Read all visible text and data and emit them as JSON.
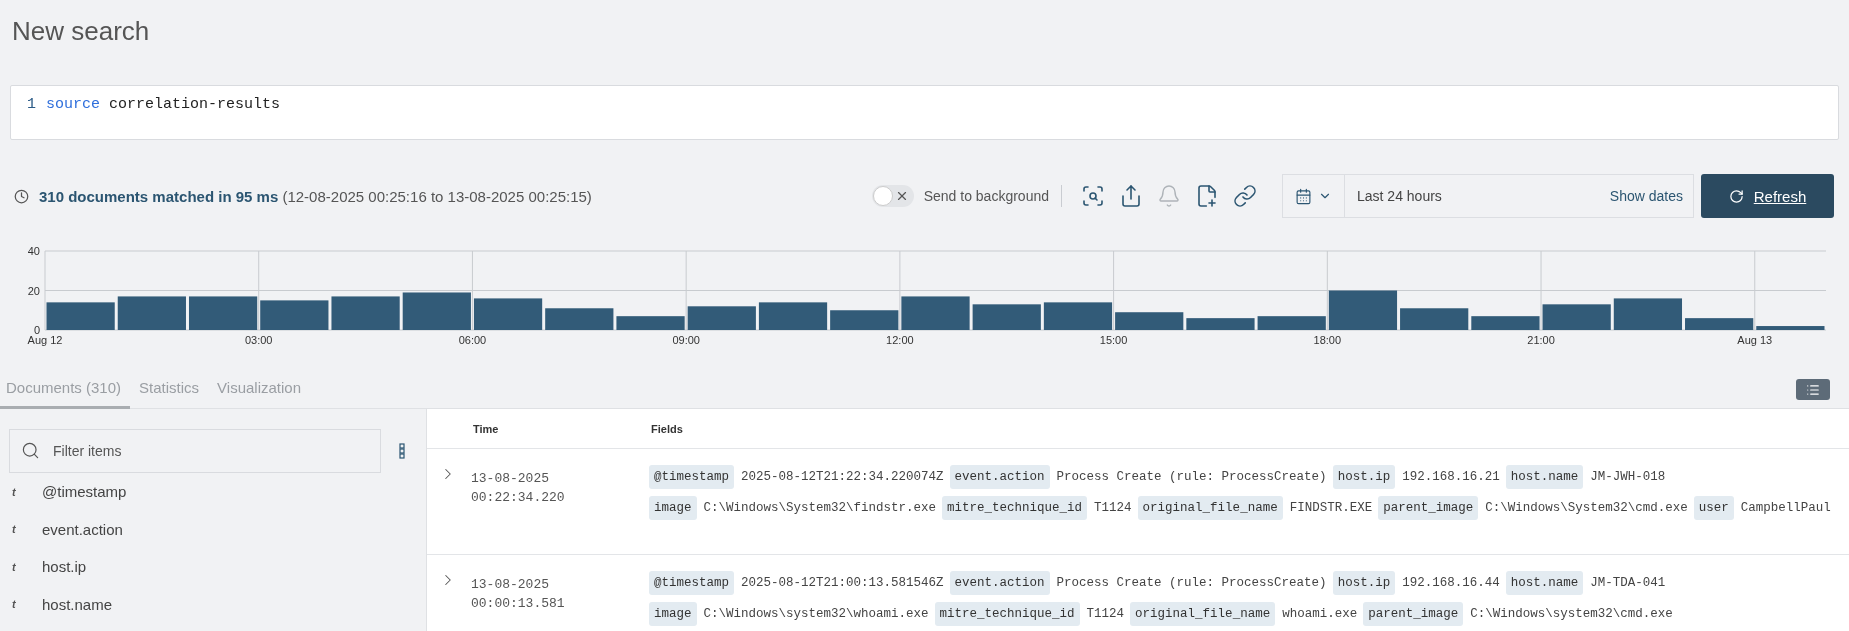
{
  "page_title": "New search",
  "query": {
    "line_number": "1",
    "keyword": "source",
    "argument": "correlation-results"
  },
  "summary": {
    "matched": "310 documents matched in 95 ms",
    "range": "(12-08-2025 00:25:16 to 13-08-2025 00:25:15)"
  },
  "background_toggle": {
    "label": "Send to background",
    "on": false
  },
  "toolbar_icons": [
    {
      "kind": "inspect",
      "disabled": false
    },
    {
      "kind": "export",
      "disabled": false
    },
    {
      "kind": "alert",
      "disabled": true
    },
    {
      "kind": "add-report",
      "disabled": false
    },
    {
      "kind": "link",
      "disabled": false
    }
  ],
  "time_range": {
    "value": "Last 24 hours",
    "show_dates": "Show dates"
  },
  "refresh_button": "Refresh",
  "histogram": {
    "chart_data": {
      "type": "bar",
      "x": [
        0.5,
        1.5,
        2.5,
        3.5,
        4.5,
        5.5,
        6.5,
        7.5,
        8.5,
        9.5,
        10.5,
        11.5,
        12.5,
        13.5,
        14.5,
        15.5,
        16.5,
        17.5,
        18.5,
        19.5,
        20.5,
        21.5,
        22.5,
        23.5,
        24.5
      ],
      "values": [
        14,
        17,
        17,
        15,
        17,
        19,
        16,
        11,
        7,
        12,
        14,
        10,
        17,
        13,
        14,
        9,
        6,
        7,
        20,
        11,
        7,
        13,
        16,
        6,
        2
      ],
      "xlim": [
        0,
        25
      ],
      "ylim": [
        0,
        40
      ],
      "grid": true,
      "yticks": [
        0,
        20,
        40
      ],
      "xticks": [
        {
          "value": 0,
          "label": "Aug 12"
        },
        {
          "value": 3,
          "label": "03:00"
        },
        {
          "value": 6,
          "label": "06:00"
        },
        {
          "value": 9,
          "label": "09:00"
        },
        {
          "value": 12,
          "label": "12:00"
        },
        {
          "value": 15,
          "label": "15:00"
        },
        {
          "value": 18,
          "label": "18:00"
        },
        {
          "value": 21,
          "label": "21:00"
        },
        {
          "value": 24,
          "label": "Aug 13"
        }
      ]
    }
  },
  "tabs": [
    {
      "label": "Documents (310)",
      "selected": true
    },
    {
      "label": "Statistics",
      "selected": false
    },
    {
      "label": "Visualization",
      "selected": false
    }
  ],
  "filter": {
    "placeholder": "Filter items"
  },
  "field_list": [
    {
      "type": "t",
      "name": "@timestamp"
    },
    {
      "type": "t",
      "name": "event.action"
    },
    {
      "type": "t",
      "name": "host.ip"
    },
    {
      "type": "t",
      "name": "host.name"
    }
  ],
  "table": {
    "columns": [
      "Time",
      "Fields"
    ],
    "rows": [
      {
        "date": "13-08-2025",
        "time": "00:22:34.220",
        "expanded": false,
        "fields": [
          {
            "key": "@timestamp",
            "value": "2025-08-12T21:22:34.220074Z"
          },
          {
            "key": "event.action",
            "value": "Process Create (rule: ProcessCreate)"
          },
          {
            "key": "host.ip",
            "value": "192.168.16.21"
          },
          {
            "key": "host.name",
            "value": "JM-JWH-018"
          },
          {
            "key": "image",
            "value": "C:\\Windows\\System32\\findstr.exe"
          },
          {
            "key": "mitre_technique_id",
            "value": "T1124"
          },
          {
            "key": "original_file_name",
            "value": "FINDSTR.EXE"
          },
          {
            "key": "parent_image",
            "value": "C:\\Windows\\System32\\cmd.exe"
          },
          {
            "key": "user",
            "value": "CampbellPaul"
          }
        ]
      },
      {
        "date": "13-08-2025",
        "time": "00:00:13.581",
        "expanded": false,
        "fields": [
          {
            "key": "@timestamp",
            "value": "2025-08-12T21:00:13.581546Z"
          },
          {
            "key": "event.action",
            "value": "Process Create (rule: ProcessCreate)"
          },
          {
            "key": "host.ip",
            "value": "192.168.16.44"
          },
          {
            "key": "host.name",
            "value": "JM-TDA-041"
          },
          {
            "key": "image",
            "value": "C:\\Windows\\system32\\whoami.exe"
          },
          {
            "key": "mitre_technique_id",
            "value": "T1124"
          },
          {
            "key": "original_file_name",
            "value": "whoami.exe"
          },
          {
            "key": "parent_image",
            "value": "C:\\Windows\\system32\\cmd.exe"
          }
        ]
      }
    ]
  }
}
